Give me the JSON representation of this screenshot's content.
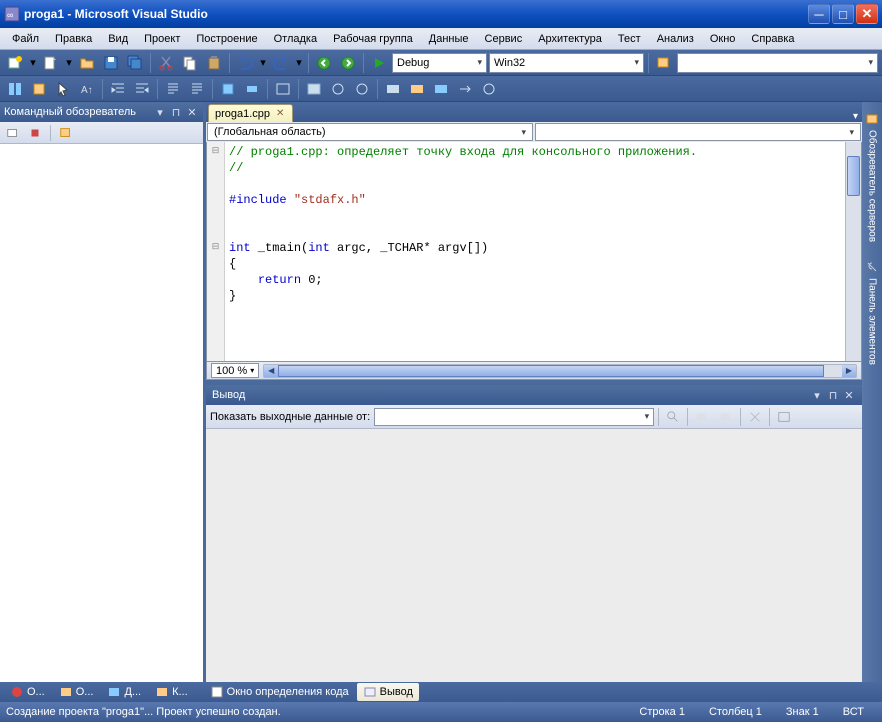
{
  "title": "proga1 - Microsoft Visual Studio",
  "menu": [
    "Файл",
    "Правка",
    "Вид",
    "Проект",
    "Построение",
    "Отладка",
    "Рабочая группа",
    "Данные",
    "Сервис",
    "Архитектура",
    "Тест",
    "Анализ",
    "Окно",
    "Справка"
  ],
  "toolbar": {
    "config": "Debug",
    "platform": "Win32"
  },
  "leftPane": {
    "title": "Командный обозреватель"
  },
  "editor": {
    "tab": "proga1.cpp",
    "scopeCombo": "(Глобальная область)",
    "zoom": "100 %",
    "code": {
      "l1a": "// proga1.cpp",
      "l1b": ": определяет точку входа для консольного приложения.",
      "l2": "//",
      "l3": "",
      "l4a": "#include ",
      "l4b": "\"stdafx.h\"",
      "l5": "",
      "l6": "",
      "l7a": "int",
      "l7b": " _tmain(",
      "l7c": "int",
      "l7d": " argc, _TCHAR* argv[])",
      "l8": "{",
      "l9a": "    ",
      "l9b": "return",
      "l9c": " 0;",
      "l10": "}"
    }
  },
  "output": {
    "title": "Вывод",
    "label": "Показать выходные данные от:"
  },
  "bottomTabs": {
    "t1": "О...",
    "t2": "О...",
    "t3": "Д...",
    "t4": "К...",
    "t5": "Окно определения кода",
    "t6": "Вывод"
  },
  "rightTabs": {
    "t1": "Обозреватель серверов",
    "t2": "Панель элементов"
  },
  "status": {
    "msg": "Создание проекта \"proga1\"... Проект успешно создан.",
    "line": "Строка 1",
    "col": "Столбец 1",
    "char": "Знак 1",
    "ins": "ВСТ"
  }
}
